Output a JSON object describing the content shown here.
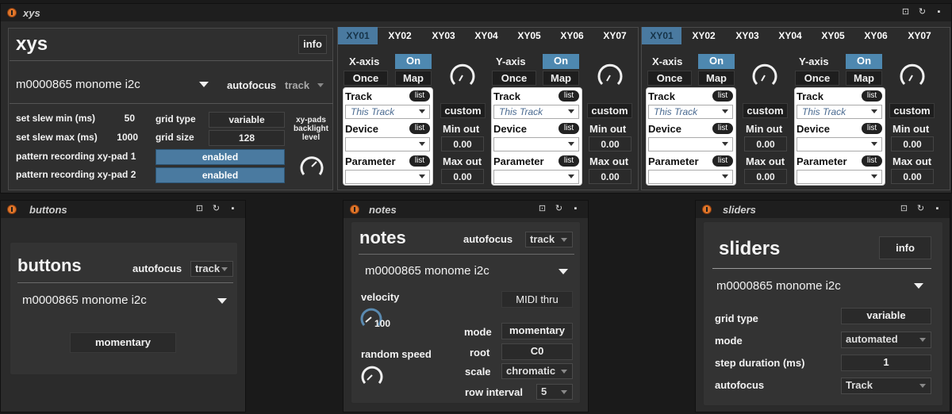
{
  "xys": {
    "title": "xys",
    "heading": "xys",
    "info_label": "info",
    "device_menu": "m0000865 monome i2c",
    "autofocus_label": "autofocus",
    "autofocus_value": "track",
    "set_slew_min_label": "set slew min (ms)",
    "set_slew_min_value": "50",
    "set_slew_max_label": "set slew max (ms)",
    "set_slew_max_value": "1000",
    "grid_type_label": "grid type",
    "grid_type_value": "variable",
    "grid_size_label": "grid size",
    "grid_size_value": "128",
    "pattern1_label": "pattern recording xy-pad 1",
    "pattern1_value": "enabled",
    "pattern2_label": "pattern recording xy-pad 2",
    "pattern2_value": "enabled",
    "backlight_label_1": "xy-pads",
    "backlight_label_2": "backlight",
    "backlight_label_3": "level",
    "tabs": [
      "XY01",
      "XY02",
      "XY03",
      "XY04",
      "XY05",
      "XY06",
      "XY07"
    ],
    "active_tab": "XY01",
    "xaxis_label": "X-axis",
    "yaxis_label": "Y-axis",
    "on_label": "On",
    "once_label": "Once",
    "map_label": "Map",
    "track_label": "Track",
    "this_track": "This Track",
    "device_label": "Device",
    "parameter_label": "Parameter",
    "list_label": "list",
    "custom_label": "custom",
    "min_out_label": "Min out",
    "min_out_value": "0.00",
    "max_out_label": "Max out",
    "max_out_value": "0.00"
  },
  "buttons": {
    "title": "buttons",
    "heading": "buttons",
    "autofocus_label": "autofocus",
    "autofocus_value": "track",
    "device_menu": "m0000865 monome i2c",
    "mode_value": "momentary"
  },
  "notes": {
    "title": "notes",
    "heading": "notes",
    "autofocus_label": "autofocus",
    "autofocus_value": "track",
    "device_menu": "m0000865 monome i2c",
    "velocity_label": "velocity",
    "velocity_value": "100",
    "midi_thru_label": "MIDI thru",
    "random_speed_label": "random speed",
    "mode_label": "mode",
    "mode_value": "momentary",
    "root_label": "root",
    "root_value": "C0",
    "scale_label": "scale",
    "scale_value": "chromatic",
    "row_interval_label": "row interval",
    "row_interval_value": "5"
  },
  "sliders": {
    "title": "sliders",
    "heading": "sliders",
    "info_label": "info",
    "device_menu": "m0000865 monome i2c",
    "grid_type_label": "grid type",
    "grid_type_value": "variable",
    "mode_label": "mode",
    "mode_value": "automated",
    "step_duration_label": "step duration (ms)",
    "step_duration_value": "1",
    "autofocus_label": "autofocus",
    "autofocus_value": "Track"
  },
  "colors": {
    "accent": "#4a7aa0",
    "title_icon": "#e0762a",
    "background": "#1a1a1a"
  }
}
